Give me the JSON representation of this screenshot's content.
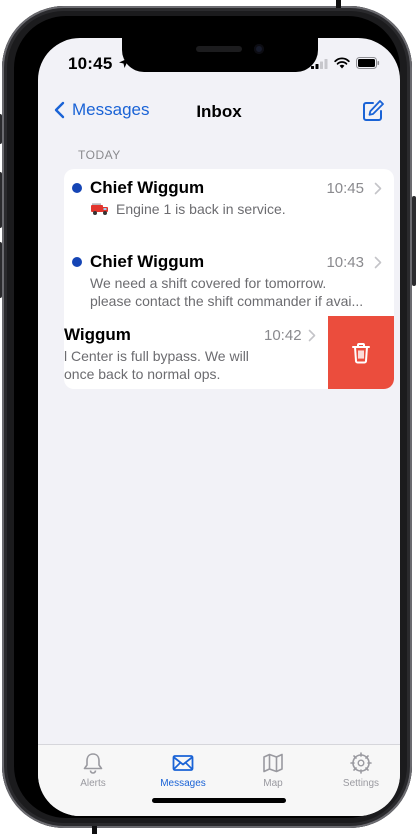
{
  "status_bar": {
    "time": "10:45"
  },
  "nav": {
    "back_label": "Messages",
    "title": "Inbox"
  },
  "section": {
    "header": "TODAY"
  },
  "messages": [
    {
      "sender": "Chief Wiggum",
      "time": "10:45",
      "preview": "Engine 1 is back in service.",
      "unread": true
    },
    {
      "sender": "Chief Wiggum",
      "time": "10:43",
      "preview_line1": "We need a shift covered for tomorrow.",
      "preview_line2": "please contact the shift commander if avai...",
      "unread": true
    },
    {
      "sender": "Wiggum",
      "time": "10:42",
      "preview_line1": "l Center is full bypass. We will",
      "preview_line2": "once back to normal ops.",
      "unread": false
    }
  ],
  "tabs": [
    {
      "label": "Alerts",
      "icon": "bell-icon",
      "active": false
    },
    {
      "label": "Messages",
      "icon": "envelope-icon",
      "active": true
    },
    {
      "label": "Map",
      "icon": "map-icon",
      "active": false
    },
    {
      "label": "Settings",
      "icon": "gear-icon",
      "active": false
    }
  ],
  "colors": {
    "accent": "#1a63d6",
    "unread_dot": "#1545b5",
    "delete": "#eb4d3d",
    "background": "#f2f2f7"
  }
}
